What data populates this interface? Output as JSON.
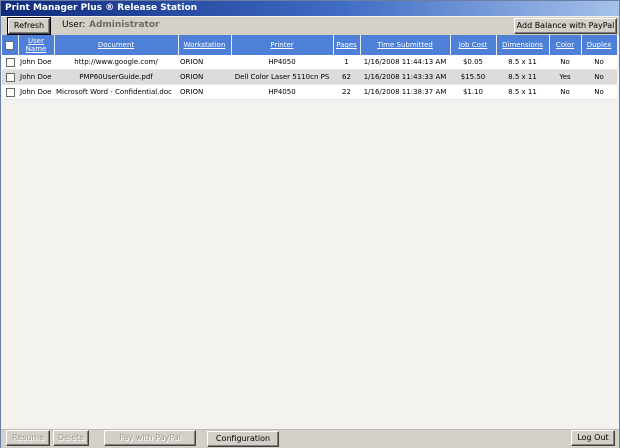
{
  "window": {
    "title": "Print Manager Plus ® Release Station"
  },
  "toolbar": {
    "refresh_label": "Refresh",
    "user_label": "User:",
    "user_name": "Administrator",
    "add_balance_label": "Add Balance with PayPal"
  },
  "table": {
    "columns": {
      "user_name": "User Name",
      "document": "Document",
      "workstation": "Workstation",
      "printer": "Printer",
      "pages": "Pages",
      "time_submitted": "Time Submitted",
      "job_cost": "Job Cost",
      "dimensions": "Dimensions",
      "color": "Color",
      "duplex": "Duplex"
    },
    "rows": [
      {
        "user": "John Doe",
        "document": "http://www.google.com/",
        "workstation": "ORION",
        "printer": "HP4050",
        "pages": "1",
        "time": "1/16/2008 11:44:13 AM",
        "cost": "$0.05",
        "dimensions": "8.5 x 11",
        "color": "No",
        "duplex": "No"
      },
      {
        "user": "John Doe",
        "document": "PMP60UserGuide.pdf",
        "workstation": "ORION",
        "printer": "Dell Color Laser 5110cn PS",
        "pages": "62",
        "time": "1/16/2008 11:43:33 AM",
        "cost": "$15.50",
        "dimensions": "8.5 x 11",
        "color": "Yes",
        "duplex": "No"
      },
      {
        "user": "John Doe",
        "document": "Microsoft Word - Confidential.doc",
        "workstation": "ORION",
        "printer": "HP4050",
        "pages": "22",
        "time": "1/16/2008 11:38:37 AM",
        "cost": "$1.10",
        "dimensions": "8.5 x 11",
        "color": "No",
        "duplex": "No"
      }
    ]
  },
  "bottombar": {
    "resume_label": "Resume",
    "delete_label": "Delete",
    "pay_label": "Pay with PayPal",
    "configuration_label": "Configuration",
    "logout_label": "Log Out"
  }
}
